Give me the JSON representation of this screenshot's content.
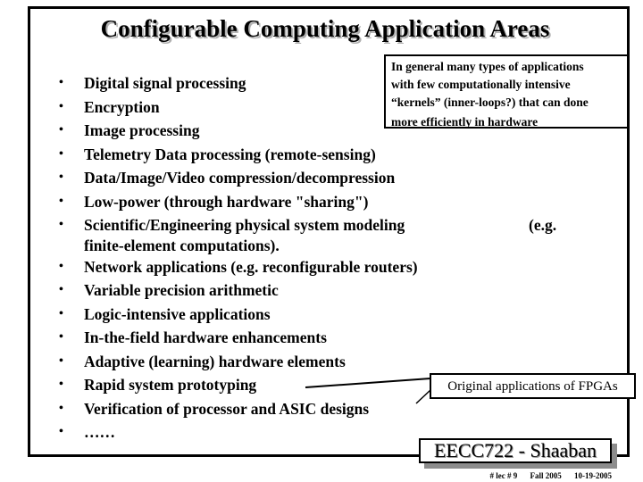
{
  "slide": {
    "title": "Configurable Computing Application Areas",
    "bullets": [
      {
        "text": "Digital signal processing"
      },
      {
        "text": "Encryption"
      },
      {
        "text": "Image processing"
      },
      {
        "text": "Telemetry Data processing (remote-sensing)"
      },
      {
        "text": "Data/Image/Video compression/decompression"
      },
      {
        "text": "Low-power (through hardware \"sharing\")"
      },
      {
        "text": "Scientific/Engineering physical system modeling",
        "text_right": "(e.g.",
        "continuation": "finite-element computations)."
      },
      {
        "text": "Network applications (e.g. reconfigurable routers)"
      },
      {
        "text": "Variable precision arithmetic"
      },
      {
        "text": "Logic-intensive applications"
      },
      {
        "text": "In-the-field hardware enhancements"
      },
      {
        "text": "Adaptive (learning) hardware elements"
      },
      {
        "text": "Rapid system prototyping"
      },
      {
        "text": "Verification of processor and ASIC designs"
      },
      {
        "text": "……"
      }
    ],
    "bullet_glyph": "•",
    "callout_general": {
      "lines": [
        "In general many types of applications",
        "with few computationally intensive",
        "“kernels” (inner-loops?) that can done",
        "more efficiently in hardware"
      ]
    },
    "callout_fpga": {
      "text": "Original applications of FPGAs"
    }
  },
  "footer": {
    "course": "EECC722 - Shaaban",
    "lecture": "#  lec # 9",
    "term": "Fall 2005",
    "date": "10-19-2005"
  }
}
